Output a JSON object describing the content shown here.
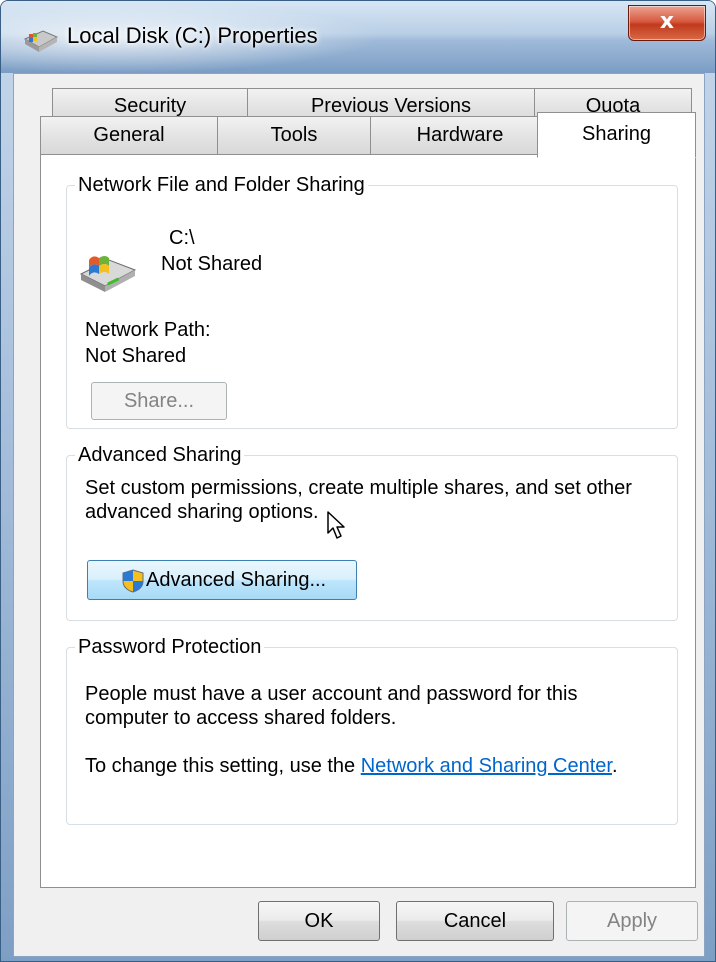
{
  "window": {
    "title": "Local Disk (C:) Properties",
    "close_label": "x"
  },
  "tabs": {
    "row1": [
      {
        "label": "Security"
      },
      {
        "label": "Previous Versions"
      },
      {
        "label": "Quota"
      }
    ],
    "row2": [
      {
        "label": "General"
      },
      {
        "label": "Tools"
      },
      {
        "label": "Hardware"
      },
      {
        "label": "Sharing",
        "active": true
      }
    ]
  },
  "network_sharing": {
    "group_title": "Network File and Folder Sharing",
    "drive_name": "C:\\",
    "drive_status": "Not Shared",
    "path_label": "Network Path:",
    "path_value": "Not Shared",
    "share_button": "Share..."
  },
  "advanced_sharing": {
    "group_title": "Advanced Sharing",
    "description_line1": "Set custom permissions, create multiple shares, and set other",
    "description_line2": "advanced sharing options.",
    "button_label": "Advanced Sharing..."
  },
  "password_protection": {
    "group_title": "Password Protection",
    "line1": "People must have a user account and password for this",
    "line2": "computer to access shared folders.",
    "change_prefix": "To change this setting, use the ",
    "link_text": "Network and Sharing Center",
    "change_suffix": "."
  },
  "footer": {
    "ok": "OK",
    "cancel": "Cancel",
    "apply": "Apply"
  },
  "icons": [
    "drive-icon",
    "shield-icon",
    "close-icon",
    "cursor-pointer-icon"
  ],
  "colors": {
    "link": "#0066cc",
    "close_button": "#c03a1e",
    "title_bar": "#b9cfe6"
  }
}
